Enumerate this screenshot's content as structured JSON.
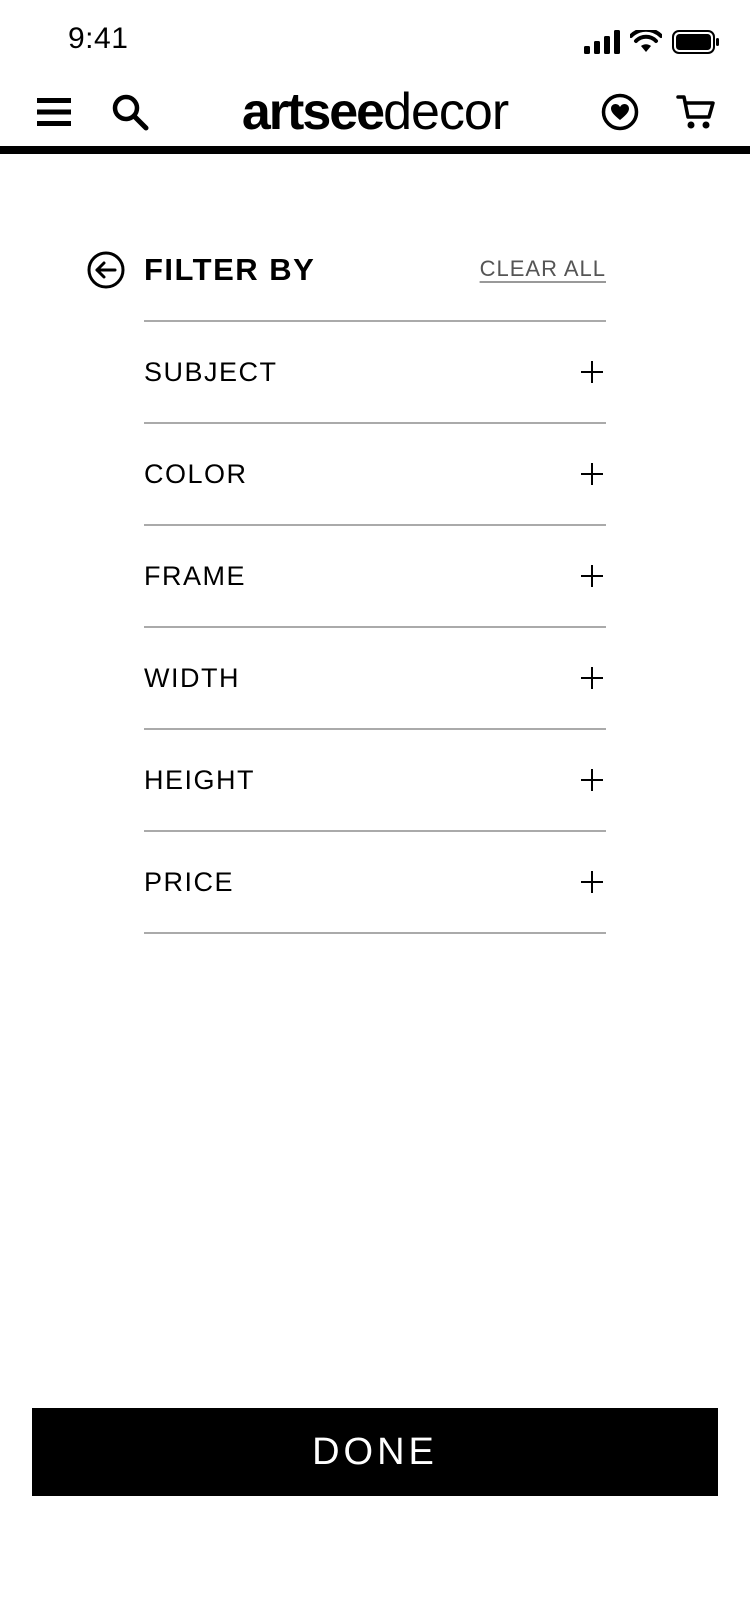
{
  "status_bar": {
    "time": "9:41"
  },
  "header": {
    "logo_bold": "artsee",
    "logo_light": "decor",
    "icons": [
      "menu-icon",
      "search-icon",
      "wishlist-heart-icon",
      "cart-icon"
    ]
  },
  "filter": {
    "title": "FILTER BY",
    "clear_all": "CLEAR ALL",
    "items": [
      {
        "label": "SUBJECT"
      },
      {
        "label": "COLOR"
      },
      {
        "label": "FRAME"
      },
      {
        "label": "WIDTH"
      },
      {
        "label": "HEIGHT"
      },
      {
        "label": "PRICE"
      }
    ]
  },
  "done_button": {
    "label": "DONE"
  },
  "colors": {
    "primary": "#000000",
    "background": "#ffffff",
    "divider": "#aaaaaa",
    "muted_text": "#555555"
  }
}
